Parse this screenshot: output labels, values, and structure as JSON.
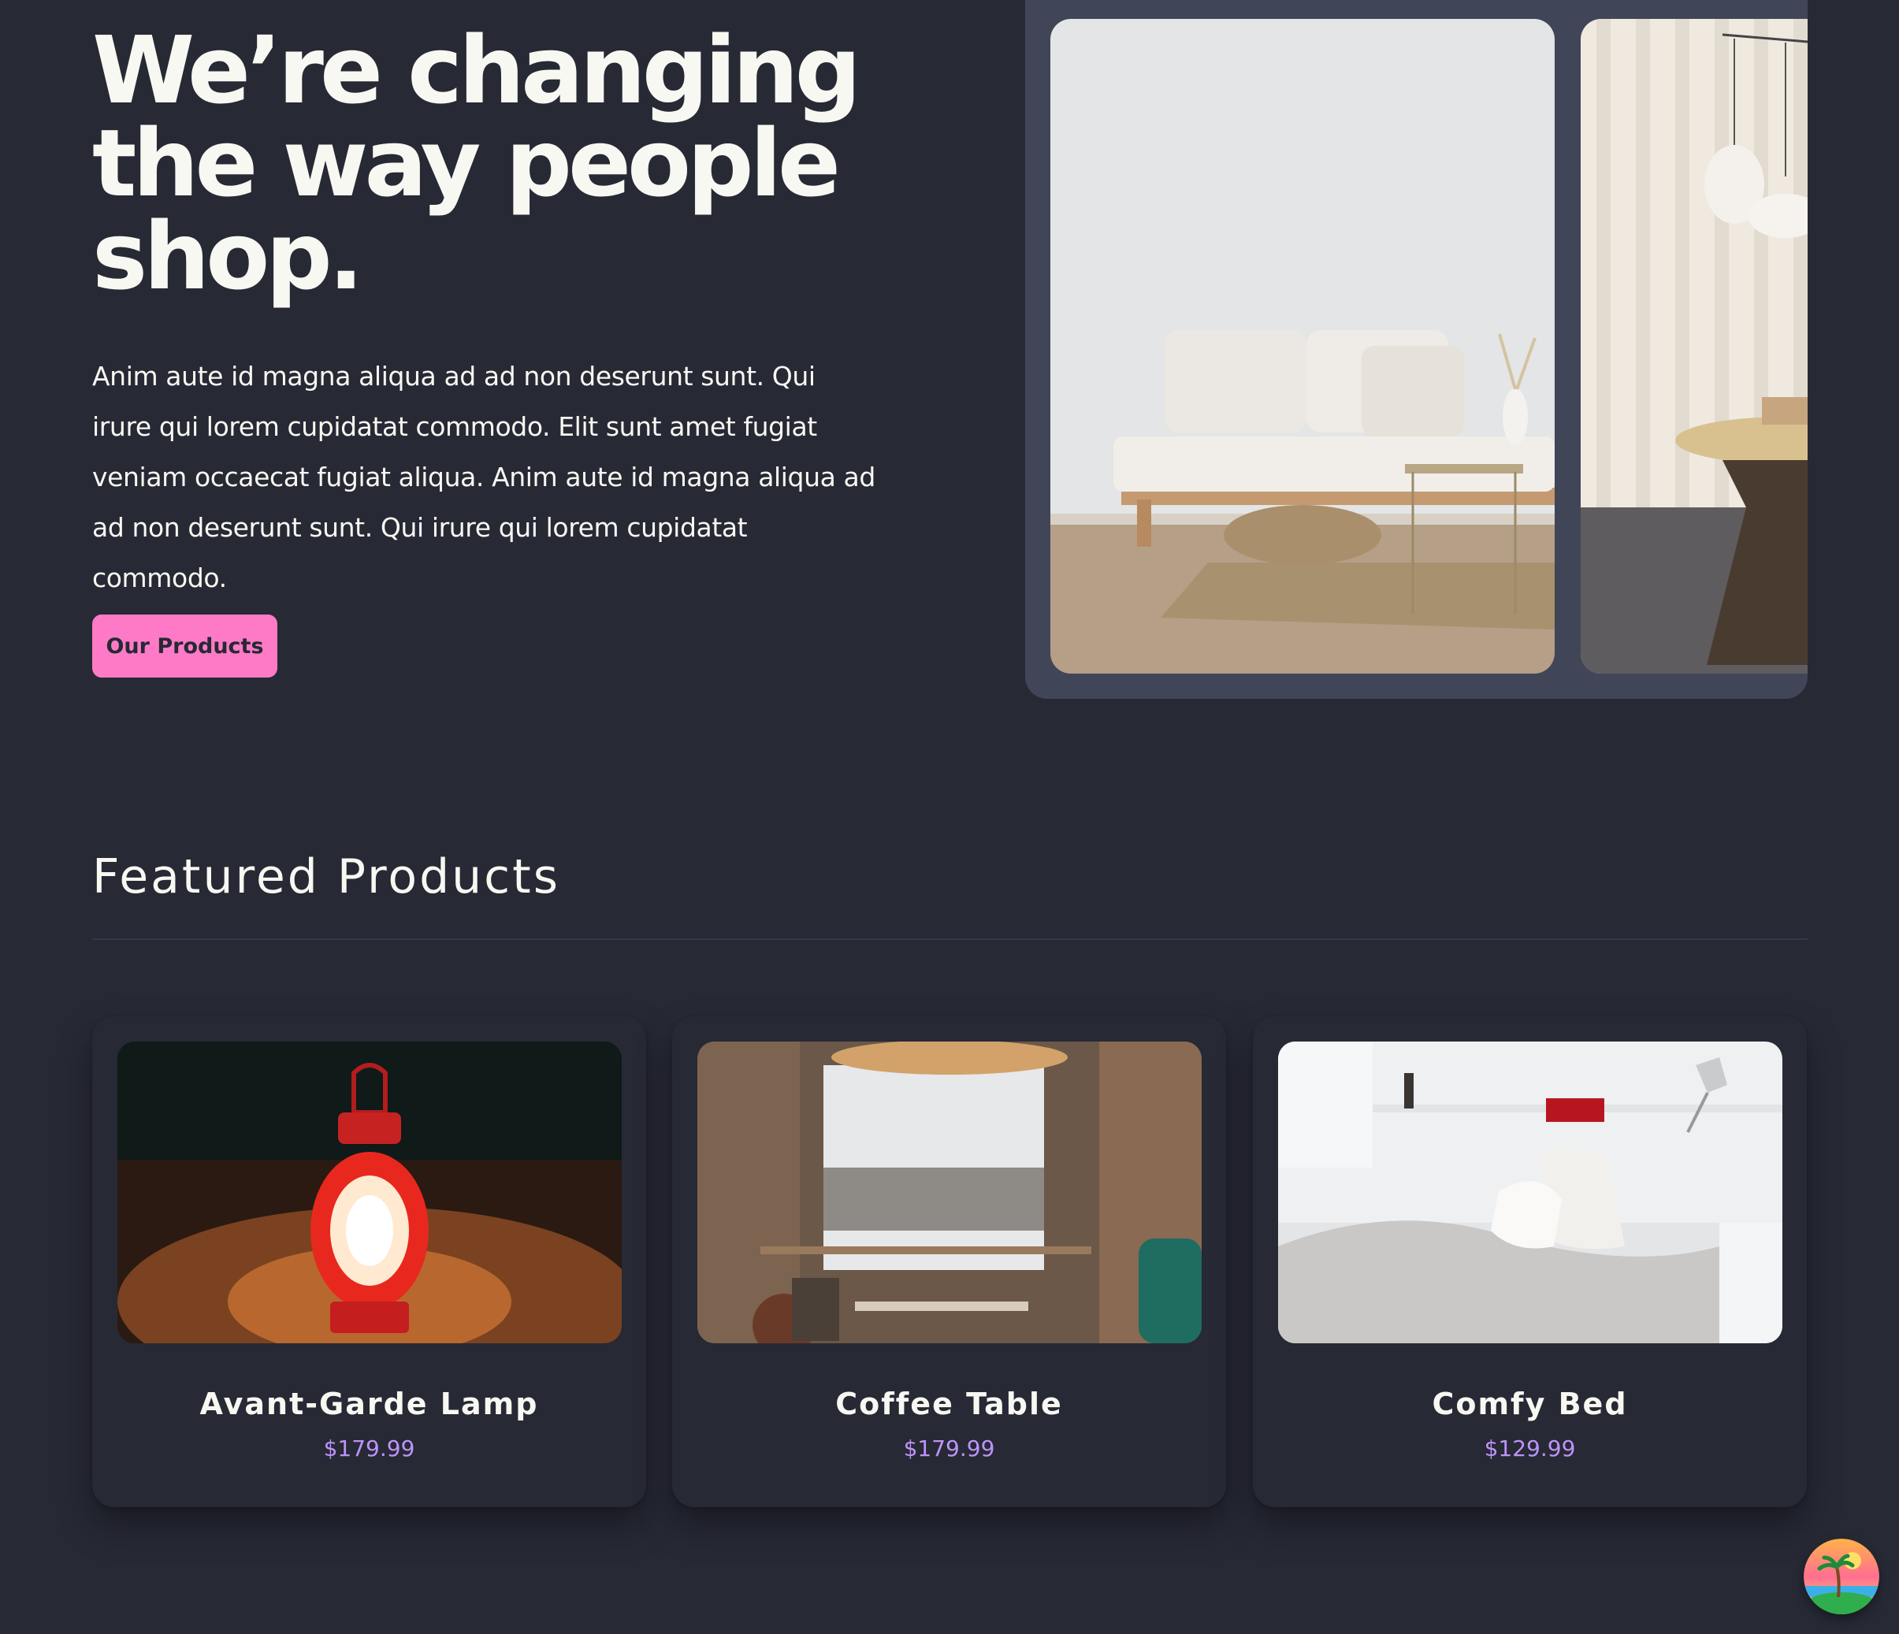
{
  "hero": {
    "title_line1": "We’re changing",
    "title_line2": "the way people",
    "title_line3": "shop.",
    "body": "Anim aute id magna aliqua ad ad non deserunt sunt. Qui irure qui lorem cupidatat commodo. Elit sunt amet fugiat veniam occaecat fugiat aliqua. Anim aute id magna aliqua ad ad non deserunt sunt. Qui irure qui lorem cupidatat commodo.",
    "cta_label": "Our Products"
  },
  "carousel": {
    "slides": [
      {
        "icon": "living-room-sofa-photo"
      },
      {
        "icon": "pendant-lamp-table-photo"
      }
    ]
  },
  "featured": {
    "title": "Featured Products",
    "products": [
      {
        "name": "Avant-Garde Lamp",
        "price": "$179.99",
        "icon": "red-lantern-photo"
      },
      {
        "name": "Coffee Table",
        "price": "$179.99",
        "icon": "cafe-interior-photo"
      },
      {
        "name": "Comfy Bed",
        "price": "$129.99",
        "icon": "white-bed-photo"
      }
    ]
  },
  "theme": {
    "background": "#272935",
    "carousel_bg": "#414558",
    "accent_pink": "#ff7ac6",
    "price_purple": "#bd93f9",
    "text": "#f8f8f2"
  },
  "fab": {
    "icon": "palm-beach-theme-icon"
  }
}
